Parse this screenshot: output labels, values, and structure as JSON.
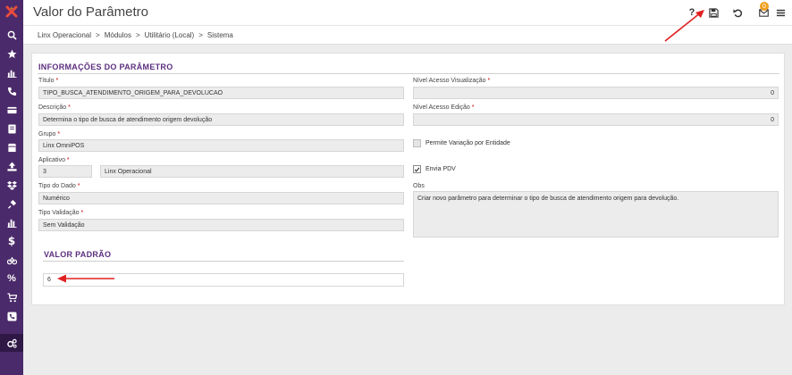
{
  "colors": {
    "sidebar": "#4a2a6a",
    "accent": "#5b2e7e",
    "required": "#cc0000",
    "annotation_arrow": "#e02020"
  },
  "header": {
    "title": "Valor do Parâmetro",
    "help_label": "?",
    "mail_badge": "0",
    "icons": [
      "help-icon",
      "save-icon",
      "undo-icon",
      "mail-icon",
      "menu-icon"
    ]
  },
  "sidebar": {
    "logo": "linx-logo-icon",
    "items": [
      "search-icon",
      "star-icon",
      "bar-chart-icon",
      "phone-icon",
      "card-icon",
      "document-icon",
      "store-icon",
      "upload-icon",
      "dropbox-icon",
      "plug-icon",
      "bar-chart-icon",
      "dollar-icon",
      "bicycle-icon",
      "percent-icon",
      "cart-icon",
      "phone-box-icon",
      "gears-icon"
    ]
  },
  "breadcrumb": {
    "items": [
      "Linx Operacional",
      "Módulos",
      "Utilitário (Local)",
      "Sistema"
    ],
    "separator": ">"
  },
  "section_info": {
    "title": "INFORMAÇÕES DO PARÂMETRO",
    "titulo": {
      "label": "Título",
      "value": "TIPO_BUSCA_ATENDIMENTO_ORIGEM_PARA_DEVOLUCAO"
    },
    "descricao": {
      "label": "Descrição",
      "value": "Determina o tipo de busca de atendimento origem devolução"
    },
    "grupo": {
      "label": "Grupo",
      "value": "Linx OmniPOS"
    },
    "aplicativo": {
      "label": "Aplicativo",
      "code": "3",
      "name": "Linx Operacional"
    },
    "tipo_dado": {
      "label": "Tipo do Dado",
      "value": "Numérico"
    },
    "tipo_validacao": {
      "label": "Tipo Validação",
      "value": "Sem Validação"
    },
    "nivel_visualizacao": {
      "label": "Nível Acesso Visualização",
      "value": "0"
    },
    "nivel_edicao": {
      "label": "Nível Acesso Edição",
      "value": "0"
    },
    "permite_variacao": {
      "label": "Permite Variação por Entidade",
      "checked": false
    },
    "envia_pdv": {
      "label": "Envia PDV",
      "checked": true
    },
    "obs": {
      "label": "Obs",
      "value": "Criar novo parâmetro para determinar o tipo de busca de atendimento origem para devolução."
    },
    "required_mark": "*"
  },
  "section_default": {
    "title": "VALOR PADRÃO",
    "value": "6"
  }
}
